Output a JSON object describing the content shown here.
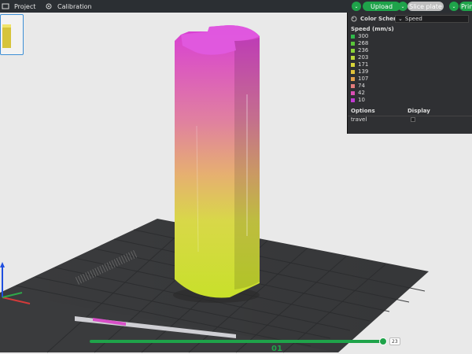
{
  "topbar": {
    "project_label": "Project",
    "calibration_label": "Calibration",
    "upload_label": "Upload",
    "slice_plate_label": "Slice plate",
    "print_label": "Print"
  },
  "panel": {
    "title": "Color Scheme",
    "selected_scheme": "Speed",
    "legend_title": "Speed (mm/s)",
    "legend": [
      {
        "value": "300",
        "color": "#2fb84a"
      },
      {
        "value": "268",
        "color": "#59c63a"
      },
      {
        "value": "236",
        "color": "#8bd43a"
      },
      {
        "value": "203",
        "color": "#bcd63a"
      },
      {
        "value": "171",
        "color": "#d7d53a"
      },
      {
        "value": "139",
        "color": "#e1c23a"
      },
      {
        "value": "107",
        "color": "#e4a04b"
      },
      {
        "value": "74",
        "color": "#e57c7c"
      },
      {
        "value": "42",
        "color": "#d94fb3"
      },
      {
        "value": "10",
        "color": "#c23bd4"
      }
    ],
    "options_label": "Options",
    "display_label": "Display",
    "option_travel": "travel"
  },
  "bottom": {
    "layer_value": "23",
    "plate_label": "01"
  },
  "colors": {
    "accent": "#1fa34a",
    "gradient_top": "#d83dd6",
    "gradient_mid": "#e6a06a",
    "gradient_bottom": "#c8e02a"
  }
}
